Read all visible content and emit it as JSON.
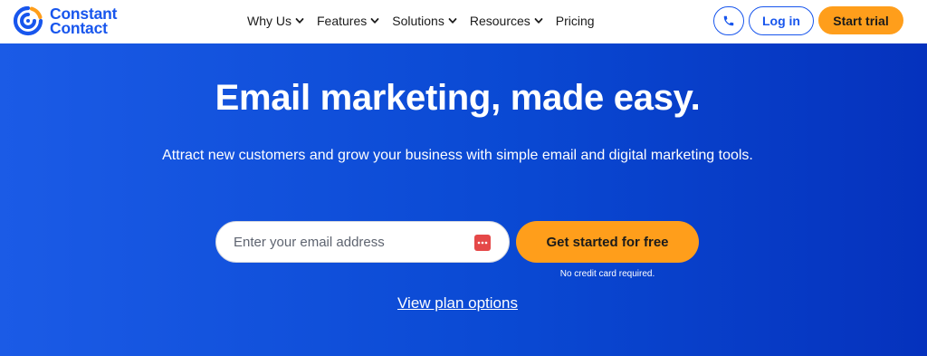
{
  "brand": {
    "name_line1": "Constant",
    "name_line2": "Contact",
    "colors": {
      "primary": "#1856ED",
      "accent": "#FF9E1B",
      "hero": "#0A49D3"
    }
  },
  "nav": {
    "items": [
      {
        "label": "Why Us",
        "has_dropdown": true
      },
      {
        "label": "Features",
        "has_dropdown": true
      },
      {
        "label": "Solutions",
        "has_dropdown": true
      },
      {
        "label": "Resources",
        "has_dropdown": true
      },
      {
        "label": "Pricing",
        "has_dropdown": false
      }
    ],
    "phone_icon": "phone-icon",
    "login_label": "Log in",
    "trial_label": "Start trial"
  },
  "hero": {
    "title": "Email marketing, made easy.",
    "subtitle": "Attract new customers and grow your business with simple email and digital marketing tools.",
    "email_placeholder": "Enter your email address",
    "email_value": "",
    "password_manager_icon": "password-manager-icon",
    "cta_label": "Get started for free",
    "cta_note": "No credit card required.",
    "plans_link": "View plan options"
  }
}
